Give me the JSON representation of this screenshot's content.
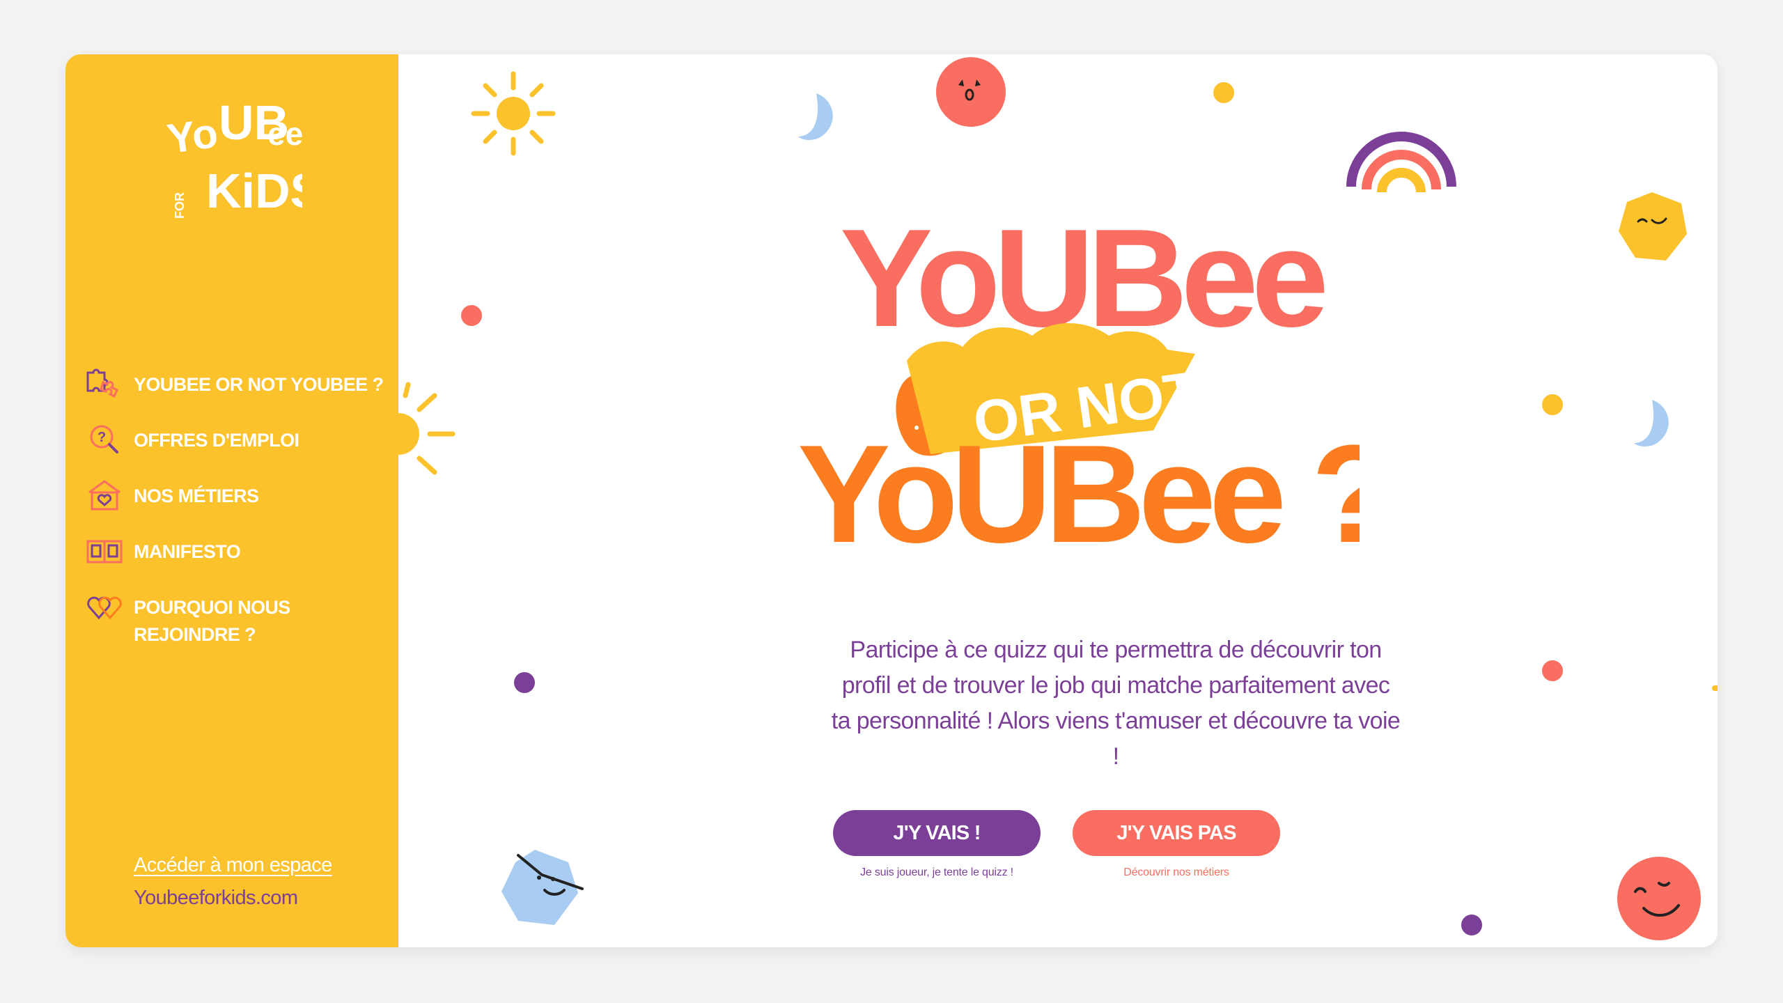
{
  "brand": {
    "logo_text": "YOUBEE FOR KIDS"
  },
  "sidebar": {
    "items": [
      {
        "label": "YOUBEE OR NOT YOUBEE ?",
        "icon": "puzzle-icon"
      },
      {
        "label": "OFFRES D'EMPLOI",
        "icon": "question-search-icon"
      },
      {
        "label": "NOS MÉTIERS",
        "icon": "house-heart-icon"
      },
      {
        "label": "MANIFESTO",
        "icon": "book-icon"
      },
      {
        "label": "POURQUOI NOUS REJOINDRE ?",
        "icon": "two-hearts-icon"
      }
    ],
    "account_link": "Accéder à mon espace",
    "site": "Youbeeforkids.com"
  },
  "hero": {
    "line1": "YoUBee",
    "badge": "OR NOT",
    "line2": "YoUBee ?"
  },
  "intro": "Participe à ce quizz qui te permettra de découvrir ton profil et de trouver le job qui matche parfaitement avec ta personnalité ! Alors viens t'amuser et découvre ta voie !",
  "cta": {
    "go_label": "J'Y VAIS !",
    "go_caption": "Je suis joueur, je tente le quizz !",
    "nogo_label": "J'Y VAIS PAS",
    "nogo_caption": "Découvrir nos métiers"
  },
  "colors": {
    "yellow": "#fcc22b",
    "purple": "#7b3f98",
    "coral": "#f96e60",
    "orange": "#fb7d1f",
    "light_blue": "#a8ccf2"
  }
}
